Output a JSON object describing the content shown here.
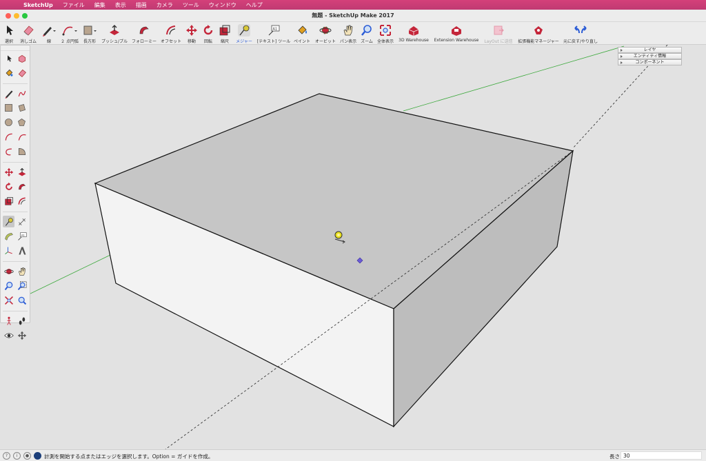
{
  "menubar": {
    "apple_glyph": "",
    "items": [
      "SketchUp",
      "ファイル",
      "編集",
      "表示",
      "描画",
      "カメラ",
      "ツール",
      "ウィンドウ",
      "ヘルプ"
    ],
    "bg_color": "#c83c76"
  },
  "window": {
    "title": "無題 - SketchUp Make 2017",
    "traffic_colors": [
      "#fe5f57",
      "#febc2e",
      "#28c840"
    ]
  },
  "toolbar": {
    "select": "選択",
    "eraser": "消しゴム",
    "line": "線",
    "arc": "２ 点円弧",
    "rectangle": "長方形",
    "pushpull": "プッシュ/プル",
    "followme": "フォローミー",
    "offset": "オフセット",
    "move": "移動",
    "rotate": "回転",
    "scale": "縮尺",
    "tape": "メジャー",
    "text": "[テキスト] ツール",
    "paint": "ペイント",
    "orbit": "オービット",
    "pan": "パン表示",
    "zoom": "ズーム",
    "zoom_extents": "全体表示",
    "warehouse": "3D Warehouse",
    "ext_warehouse": "Extension Warehouse",
    "layout": "LayOut に送信",
    "ext_manager": "拡張機能マネージャー",
    "undo_redo": "元に戻す/やり直し",
    "accent_color": "#c4263a",
    "active_label_color": "#2b5cd6"
  },
  "tray": {
    "items": [
      "レイヤ",
      "エンティティ情報",
      "コンポーネント"
    ]
  },
  "status": {
    "message": "計測を開始する点またはエッジを選択します。Option = ガイドを作成。",
    "measure_label": "長さ",
    "measure_value": "30"
  },
  "scene": {
    "axis_green": "#3aa83a",
    "box_top_color": "#c6c6c6",
    "box_front_color": "#f2f2f2",
    "box_right_color": "#bdbdbd",
    "cursor_icon": "tape-measure-cursor-icon",
    "inference_point_color": "#6b5bd6"
  }
}
